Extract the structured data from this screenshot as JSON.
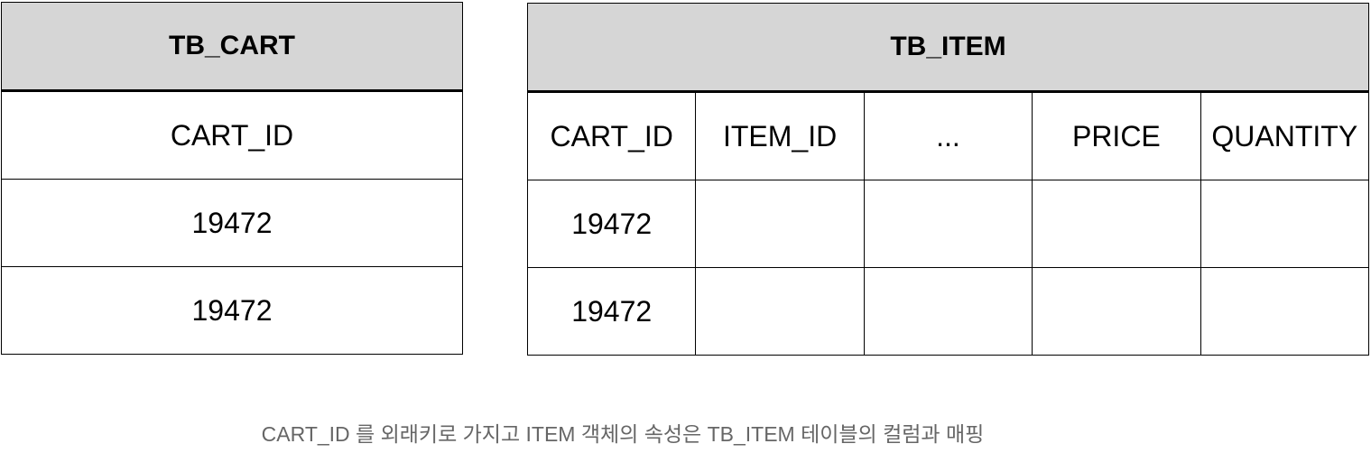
{
  "cart_table": {
    "name": "TB_CART",
    "header": "CART_ID",
    "rows": [
      "19472",
      "19472"
    ]
  },
  "item_table": {
    "name": "TB_ITEM",
    "columns": [
      "CART_ID",
      "ITEM_ID",
      "...",
      "PRICE",
      "QUANTITY"
    ],
    "rows": [
      [
        "19472",
        "",
        "",
        "",
        ""
      ],
      [
        "19472",
        "",
        "",
        "",
        ""
      ]
    ]
  },
  "caption": "CART_ID 를 외래키로 가지고 ITEM 객체의 속성은 TB_ITEM 테이블의 컬럼과 매핑",
  "colors": {
    "header_bg": "#d6d6d6",
    "border": "#000000",
    "caption_text": "#666666"
  }
}
